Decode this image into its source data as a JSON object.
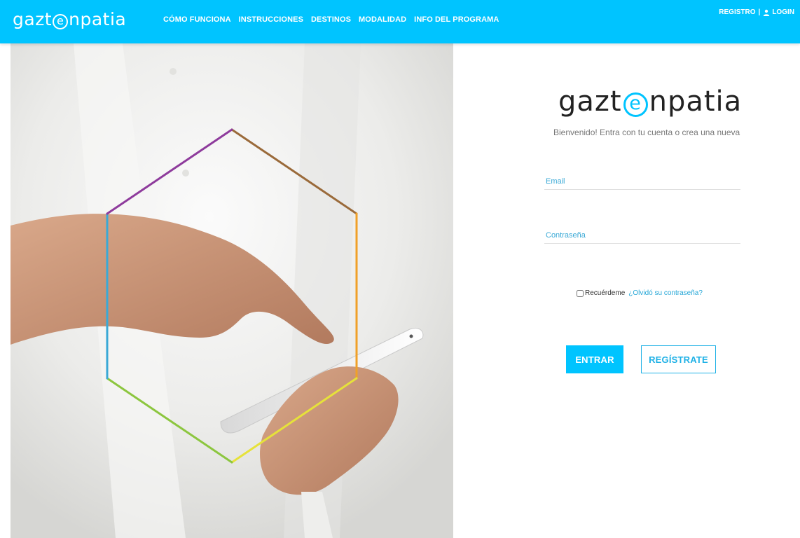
{
  "header": {
    "brand": {
      "prefix": "gazt",
      "glyph": "e",
      "suffix": "npatia"
    },
    "nav": [
      {
        "label": "CÓMO FUNCIONA"
      },
      {
        "label": "INSTRUCCIONES"
      },
      {
        "label": "DESTINOS"
      },
      {
        "label": "MODALIDAD"
      },
      {
        "label": "INFO DEL PROGRAMA"
      }
    ],
    "auth": {
      "register": "REGISTRO",
      "separator": "|",
      "login": "LOGIN",
      "icon": "user-icon"
    }
  },
  "login": {
    "logo": {
      "prefix": "gazt",
      "glyph": "e",
      "suffix": "npatia"
    },
    "welcome": "Bienvenido! Entra con tu cuenta o crea una nueva",
    "email": {
      "placeholder": "Email",
      "value": ""
    },
    "password": {
      "placeholder": "Contraseña",
      "value": ""
    },
    "remember_label": "Recuérdeme",
    "remember_checked": false,
    "forgot_link": "¿Olvidó su contraseña?",
    "login_button": "ENTRAR",
    "register_button": "REGÍSTRATE"
  },
  "colors": {
    "brand_cyan": "#00c4ff",
    "link_blue": "#26a7d7",
    "hexagon": [
      "#8e3b9c",
      "#9a6a3a",
      "#f0a028",
      "#e6e23a",
      "#8cc63f",
      "#3aa9d6"
    ]
  }
}
